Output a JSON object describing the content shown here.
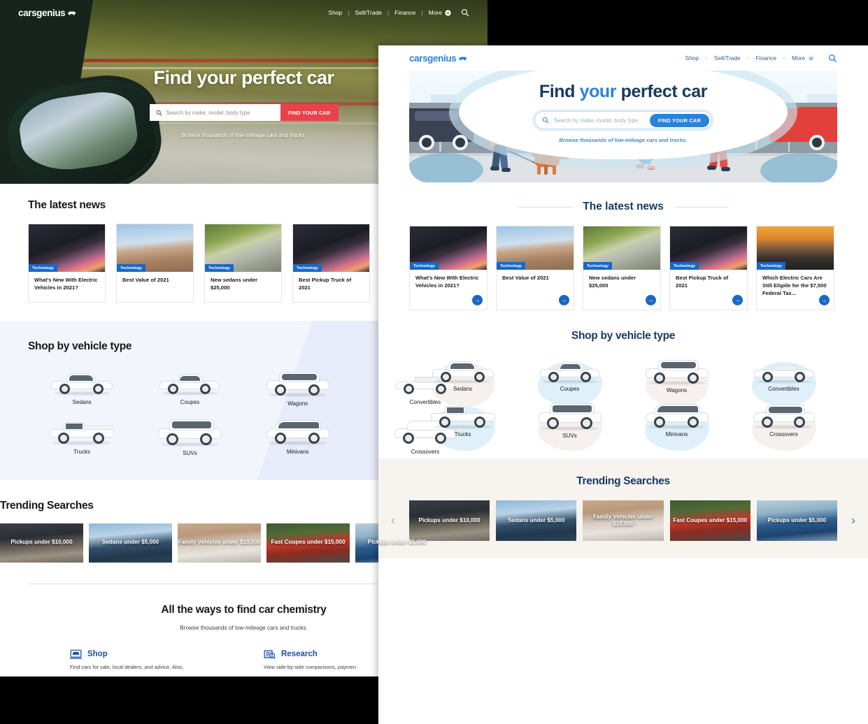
{
  "left_page": {
    "logo": "carsgenius",
    "nav": [
      "Shop",
      "Sell/Trade",
      "Finance",
      "More"
    ],
    "hero": {
      "title": "Find your perfect car",
      "search_placeholder": "Search by make, model, body type",
      "search_button": "FIND YOUR CAR",
      "subtitle": "Browse thousands of low-mileage cars and trucks."
    },
    "news": {
      "heading": "The latest news",
      "cards": [
        {
          "tag": "Technology",
          "title": "What's New With Electric Vehicles in 2021?"
        },
        {
          "tag": "Technology",
          "title": "Best Value of 2021"
        },
        {
          "tag": "Technology",
          "title": "New sedans under $25,000"
        },
        {
          "tag": "Technology",
          "title": "Best Pickup Truck of 2021"
        }
      ]
    },
    "vehicle_type": {
      "heading": "Shop by vehicle type",
      "items": [
        "Sedans",
        "Coupes",
        "Wagons",
        "Convertibles",
        "Trucks",
        "SUVs",
        "Minivans",
        "Crossovers"
      ]
    },
    "trending": {
      "heading": "Trending Searches",
      "cards": [
        "Pickups under $10,000",
        "Sedans under $5,000",
        "Family Vehicles under $10,000",
        "Fast Coupes under $15,000",
        "Pickups under $5,000"
      ]
    },
    "ways": {
      "heading": "All the ways to find car chemistry",
      "subtitle": "Browse thousands of low-mileage cars and trucks.",
      "items": [
        {
          "title": "Shop",
          "desc": "Find cars for sale, local dealers, and advice. Also,"
        },
        {
          "title": "Research",
          "desc": "View side-by-side comparisons, paymen"
        }
      ]
    }
  },
  "right_page": {
    "logo": "carsgenius",
    "nav": [
      "Shop",
      "Sell/Trade",
      "Finance",
      "More"
    ],
    "hero": {
      "title_pre": "Find ",
      "title_em": "your",
      "title_post": " perfect car",
      "search_placeholder": "Search by make, model, body type",
      "search_button": "FIND YOUR CAR",
      "subtitle": "Browse thousands of low-mileage cars and trucks."
    },
    "news": {
      "heading": "The latest news",
      "cards": [
        {
          "tag": "Technology",
          "title": "What's New With Electric Vehicles in 2021?"
        },
        {
          "tag": "Technology",
          "title": "Best Value of 2021"
        },
        {
          "tag": "Technology",
          "title": "New sedans under $25,000"
        },
        {
          "tag": "Technology",
          "title": "Best Pickup Truck of 2021"
        },
        {
          "tag": "Technology",
          "title": "Which Electric Cars Are Still Eligiile for the $7,500 Federal Tax..."
        }
      ]
    },
    "vehicle_type": {
      "heading": "Shop by vehicle type",
      "items": [
        "Sedans",
        "Coupes",
        "Wagons",
        "Convertibles",
        "Trucks",
        "SUVs",
        "Minivans",
        "Crossovers"
      ]
    },
    "trending": {
      "heading": "Trending Searches",
      "cards": [
        "Pickups under $10,000",
        "Sedans under $5,000",
        "Family Vehicles under $10,000",
        "Fast Coupes under $15,000",
        "Pickups under $5,000"
      ]
    }
  },
  "colors": {
    "brand_blue": "#2c82d6",
    "deep_navy": "#173a5e",
    "tag_blue": "#1a68c4",
    "accent_red": "#e8434a",
    "trending_bg": "#f7f4f0"
  },
  "icons": {
    "search": "search-icon",
    "chevron_down": "chevron-down-icon",
    "arrow_right": "arrow-right-icon",
    "carousel_prev": "chevron-left-icon",
    "carousel_next": "chevron-right-icon"
  }
}
